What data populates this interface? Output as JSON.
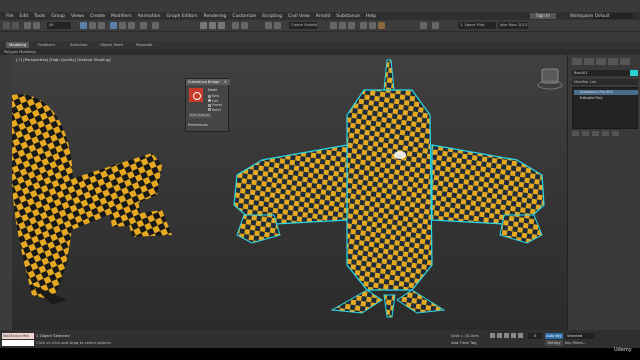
{
  "app": {
    "menu": [
      "File",
      "Edit",
      "Tools",
      "Group",
      "Views",
      "Create",
      "Modifiers",
      "Animation",
      "Graph Editors",
      "Rendering",
      "Customize",
      "Scripting",
      "Civil View",
      "Arnold",
      "Substance",
      "Help"
    ],
    "sign_in": "Sign In",
    "workspaces_label": "Workspaces:",
    "workspace_value": "Default"
  },
  "toolbar": {
    "filter_value": "All",
    "named_selection": "Create Selection Se",
    "named_sets": "1. Space Pilot",
    "project_path": "Jake Ross 2023"
  },
  "ribbon": {
    "tabs": [
      "Modeling",
      "Freeform",
      "Selection",
      "Object Paint",
      "Populate"
    ],
    "active": "Modeling",
    "sub_label": "Polygon Modeling"
  },
  "viewport": {
    "label": "[+] [Perspective] [High Quality] [Default Shading]"
  },
  "substance_bridge": {
    "title": "Substance Bridge",
    "close": "×",
    "mode_label": "Mode",
    "options": [
      "New",
      "Edit",
      "Preset",
      "Batch"
    ],
    "selected_option": "Edit",
    "button": "Edit (default)",
    "preferences": "Preferences"
  },
  "command_panel": {
    "object_name": "Box001",
    "modifier_list": "Modifier List",
    "stack": [
      "Substance Pro 003",
      "Editable Poly"
    ],
    "selected_stack_index": 0
  },
  "status": {
    "maxscript": "MAXScript Mini",
    "selection": "1 Object Selected",
    "prompt": "Click or click-and-drag to select objects",
    "grid": "Grid = 10.0cm",
    "add_time_tag": "Add Time Tag",
    "frame": "0",
    "auto_key": "Auto Key",
    "selected": "Selected",
    "set_key": "Set Key",
    "key_filters": "Key Filters..."
  },
  "watermark": "Udemy",
  "colors": {
    "checker_a": "#e6a820",
    "checker_b": "#1f2d3a",
    "outline": "#2bd6e6",
    "selection": "#4a6d8c"
  }
}
